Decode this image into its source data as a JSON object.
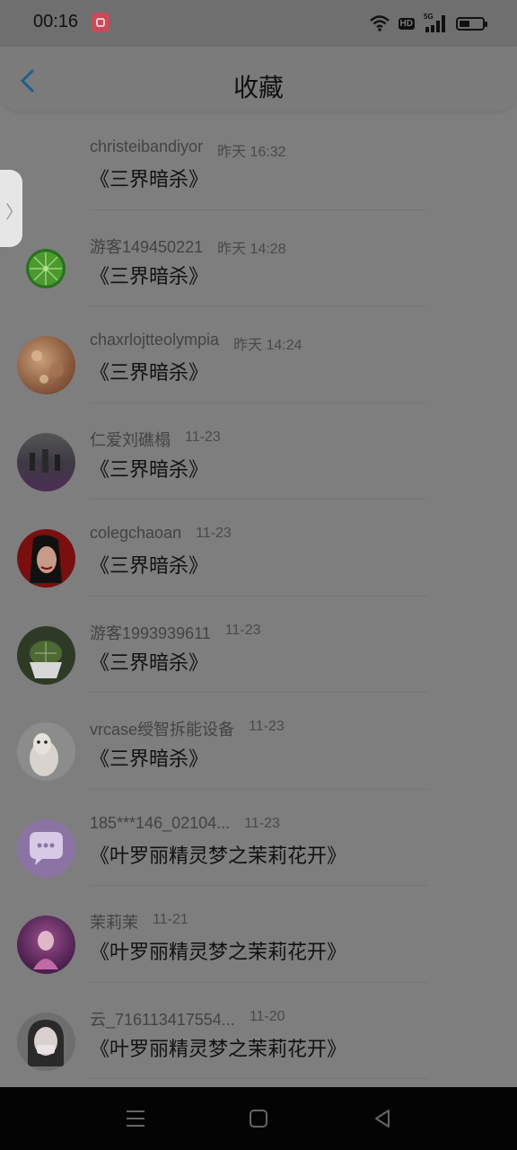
{
  "status_bar": {
    "time": "00:16",
    "network_badge": "HD",
    "signal_label": "5G",
    "battery_level": 0.45,
    "icons": [
      "app-notification-icon",
      "wifi-icon",
      "hd-icon",
      "signal-5g-icon",
      "battery-icon"
    ]
  },
  "header": {
    "title": "收藏",
    "back_icon": "chevron-left-icon",
    "accent_color": "#1e5f8c"
  },
  "side_tab": {
    "icon": "chevron-right-icon",
    "glyph": "〉"
  },
  "items": [
    {
      "name": "christeibandiyor",
      "time": "昨天 16:32",
      "title": "《三界暗杀》",
      "avatar": "none"
    },
    {
      "name": "游客149450221",
      "time": "昨天 14:28",
      "title": "《三界暗杀》",
      "avatar": "lime-slice"
    },
    {
      "name": "chaxrlojtteolympia",
      "time": "昨天 14:24",
      "title": "《三界暗杀》",
      "avatar": "bokeh-photo"
    },
    {
      "name": "仁爱刘礁榻",
      "time": "11-23",
      "title": "《三界暗杀》",
      "avatar": "street-crowd-photo"
    },
    {
      "name": "colegchaoan",
      "time": "11-23",
      "title": "《三界暗杀》",
      "avatar": "red-illustration-face"
    },
    {
      "name": "游客1993939611",
      "time": "11-23",
      "title": "《三界暗杀》",
      "avatar": "cactus-photo"
    },
    {
      "name": "vrcase绶智拆能设备",
      "time": "11-23",
      "title": "《三界暗杀》",
      "avatar": "alpaca-photo"
    },
    {
      "name": "185***146_02104...",
      "time": "11-23",
      "title": "《叶罗丽精灵梦之茉莉花开》",
      "avatar": "purple-chat-bubble"
    },
    {
      "name": "茉莉茉",
      "time": "11-21",
      "title": "《叶罗丽精灵梦之茉莉花开》",
      "avatar": "purple-doll"
    },
    {
      "name": "云_716113417554...",
      "time": "11-20",
      "title": "《叶罗丽精灵梦之茉莉花开》",
      "avatar": "anime-girl-mask"
    }
  ],
  "nav_bar": {
    "menu_icon": "menu-icon",
    "home_icon": "home-square-icon",
    "back_icon": "back-triangle-icon"
  }
}
